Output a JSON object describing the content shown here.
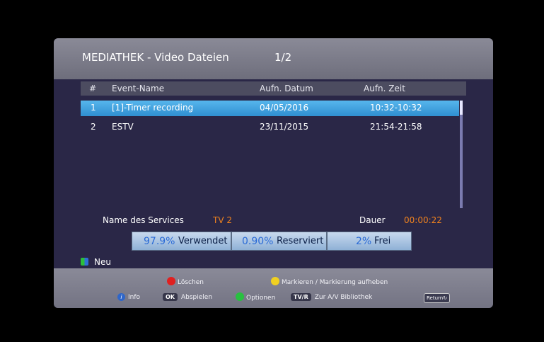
{
  "header": {
    "title": "MEDIATHEK - Video Dateien",
    "page": "1/2"
  },
  "columns": {
    "num": "#",
    "event": "Event-Name",
    "date": "Aufn. Datum",
    "time": "Aufn. Zeit"
  },
  "rows": [
    {
      "num": "1",
      "name": "[1]-Timer recording",
      "date": "04/05/2016",
      "time": "10:32-10:32",
      "selected": true
    },
    {
      "num": "2",
      "name": "ESTV",
      "date": "23/11/2015",
      "time": "21:54-21:58",
      "selected": false
    }
  ],
  "details": {
    "service_label": "Name des Services",
    "service_value": "TV 2",
    "duration_label": "Dauer",
    "duration_value": "00:00:22"
  },
  "storage": {
    "used_pct": "97.9%",
    "used_label": "Verwendet",
    "reserved_pct": "0.90%",
    "reserved_label": "Reserviert",
    "free_pct": "2%",
    "free_label": "Frei"
  },
  "neu_label": "Neu",
  "footer": {
    "delete": "Löschen",
    "mark": "Markieren / Markierung aufheben",
    "info": "Info",
    "info_key": "i",
    "ok_key": "OK",
    "play": "Abspielen",
    "options": "Optionen",
    "tvr_key": "TV/R",
    "library": "Zur A/V Bibliothek",
    "return_key": "Return"
  },
  "colors": {
    "accent_orange": "#f0821e",
    "selection_blue": "#3d9ee0",
    "red": "#e02020",
    "yellow": "#f0d020",
    "green": "#28c040"
  }
}
